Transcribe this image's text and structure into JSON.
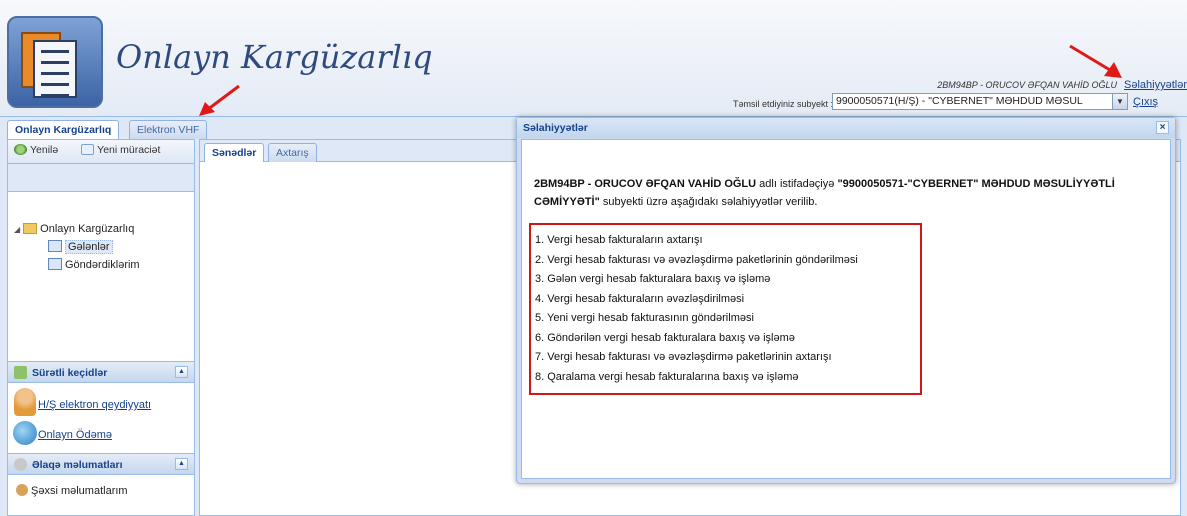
{
  "header": {
    "brand": "Onlayn Kargüzarlıq",
    "user_line": "2BM94BP - ORUCOV ƏFQAN VAHİD OĞLU",
    "permissions_link": "Səlahiyyətlər",
    "exit_link": "Çıxış",
    "subject_label": "Təmsil etdiyiniz subyekt :",
    "subject_value": "9900050571(H/Ş) - \"CYBERNET\" MƏHDUD MƏSUL"
  },
  "top_tabs": [
    {
      "label": "Onlayn Kargüzarlıq",
      "active": true
    },
    {
      "label": "Elektron VHF",
      "active": false
    }
  ],
  "left_panel": {
    "toolbar": {
      "refresh": "Yenilə",
      "new_request": "Yeni müraciət"
    },
    "tree": {
      "root": "Onlayn Kargüzarlıq",
      "children": [
        "Gələnlər",
        "Göndərdiklərim"
      ],
      "selected": "Gələnlər"
    },
    "quick_links": {
      "title": "Sürətli keçidlər",
      "items": [
        "H/Ş elektron qeydiyyatı",
        "Onlayn Ödəmə"
      ]
    },
    "contact": {
      "title": "Əlaqə məlumatları",
      "items": [
        "Şəxsi məlumatlarım"
      ]
    }
  },
  "main_tabs": [
    {
      "label": "Sənədlər",
      "active": true
    },
    {
      "label": "Axtarış",
      "active": false
    }
  ],
  "modal": {
    "title": "Səlahiyyətlər",
    "intro_user": "2BM94BP - ORUCOV ƏFQAN VAHİD OĞLU",
    "intro_mid": " adlı istifadəçiyə ",
    "intro_subject": "\"9900050571-\"CYBERNET\" MƏHDUD MƏSULİYYƏTLİ CƏMİYYƏTİ\"",
    "intro_end": " subyekti üzrə aşağıdakı səlahiyyətlər verilib.",
    "permissions": [
      "1. Vergi hesab fakturaların axtarışı",
      "2. Vergi hesab fakturası və əvəzləşdirmə paketlərinin göndərilməsi",
      "3. Gələn vergi hesab fakturalara baxış və işləmə",
      "4. Vergi hesab fakturaların əvəzləşdirilməsi",
      "5. Yeni vergi hesab fakturasının göndərilməsi",
      "6. Göndərilən vergi hesab fakturalara baxış və işləmə",
      "7. Vergi hesab fakturası və əvəzləşdirmə paketlərinin axtarışı",
      "8. Qaralama vergi hesab fakturalarına baxış və işləmə"
    ]
  },
  "colors": {
    "accent": "#15428b",
    "highlight_border": "#d21616",
    "arrow": "#e01818"
  }
}
